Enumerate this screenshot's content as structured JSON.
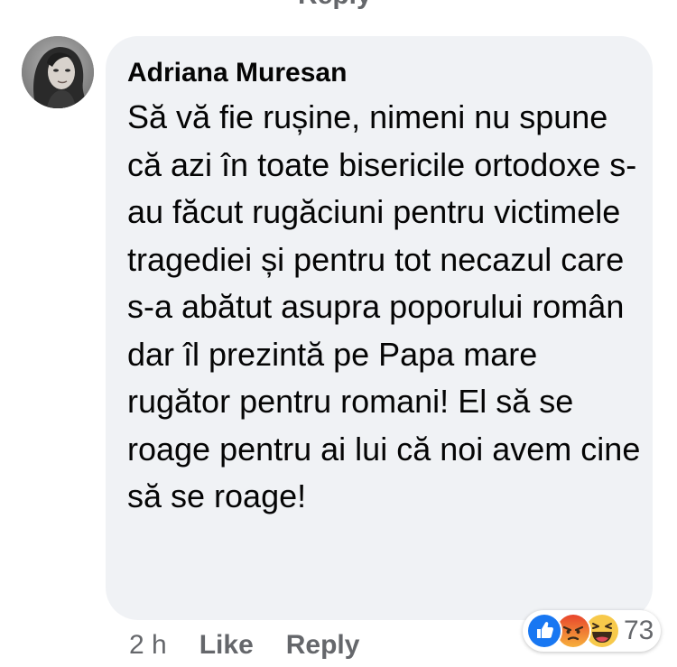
{
  "top_action": "Reply",
  "comment": {
    "author": "Adriana Muresan",
    "text": "Să vă fie rușine, nimeni nu spune că azi în toate bisericile ortodoxe s-au făcut rugăciuni pentru victimele tragediei și pentru tot necazul care s-a abătut asupra poporului român dar îl prezintă pe Papa mare rugător pentru romani! El să se roage pentru ai lui că noi avem cine să se roage!",
    "time": "2 h",
    "like_label": "Like",
    "reply_label": "Reply"
  },
  "reactions": {
    "icons": [
      "like-icon",
      "angry-icon",
      "haha-icon"
    ],
    "count": "73"
  },
  "colors": {
    "bubble": "#f0f2f5",
    "secondary_text": "#65676b",
    "like_blue": "#1877f2",
    "angry_orange": "#f05d2a",
    "haha_yellow": "#f7c94b"
  }
}
